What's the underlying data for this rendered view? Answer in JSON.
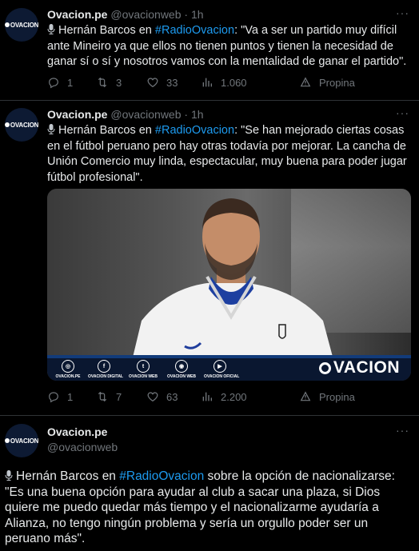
{
  "tweets": [
    {
      "name": "Ovacion.pe",
      "handle": "@ovacionweb",
      "separator": "·",
      "time": "1h",
      "avatar_text": "OVACION",
      "text_before": "Hernán Barcos en ",
      "hashtag": "#RadioOvacion",
      "text_after": ": \"Va a ser un partido muy difícil ante Mineiro ya que ellos no tienen puntos y tienen la necesidad de ganar sí o sí y nosotros vamos con la mentalidad de ganar el partido\".",
      "replies": "1",
      "retweets": "3",
      "likes": "33",
      "views": "1.060",
      "promote": "Propina"
    },
    {
      "name": "Ovacion.pe",
      "handle": "@ovacionweb",
      "separator": "·",
      "time": "1h",
      "avatar_text": "OVACION",
      "text_before": "Hernán Barcos en ",
      "hashtag": "#RadioOvacion",
      "text_after": ": \"Se han mejorado ciertas cosas en el fútbol peruano pero hay otras todavía por mejorar. La cancha de Unión Comercio muy linda, espectacular, muy buena para poder jugar fútbol profesional\".",
      "replies": "1",
      "retweets": "7",
      "likes": "63",
      "views": "2.200",
      "promote": "Propina",
      "media": {
        "social": [
          {
            "icon": "◎",
            "label": "OVACION.PE"
          },
          {
            "icon": "f",
            "label": "OVACION DIGITAL"
          },
          {
            "icon": "t",
            "label": "OVACION WEB"
          },
          {
            "icon": "◉",
            "label": "OVACION WEB"
          },
          {
            "icon": "▶",
            "label": "OVACION OFICIAL"
          }
        ],
        "brand": "VACION"
      }
    },
    {
      "name": "Ovacion.pe",
      "handle": "@ovacionweb",
      "avatar_text": "OVACION",
      "text_before": "Hernán Barcos en ",
      "hashtag": "#RadioOvacion",
      "text_after": " sobre la opción de nacionalizarse: \"Es una buena opción para ayudar al club a sacar una plaza, si Dios quiere me puedo quedar más tiempo y el nacionalizarme ayudaría a Alianza, no tengo ningún problema y sería un orgullo poder ser un peruano más\"."
    }
  ],
  "more_icon": "more-horizontal-icon",
  "colors": {
    "background": "#000000",
    "text": "#e7e9ea",
    "muted": "#71767b",
    "accent": "#1d9bf0"
  }
}
